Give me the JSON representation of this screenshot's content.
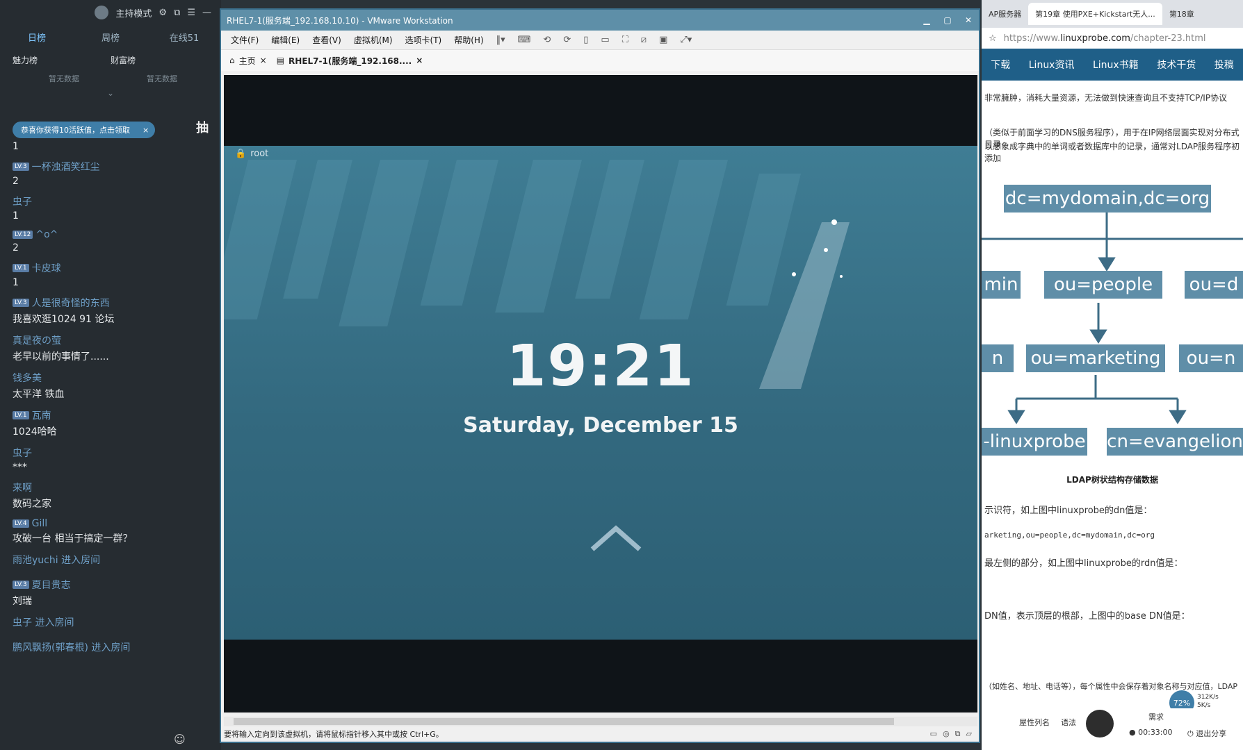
{
  "chat": {
    "mode": "主持模式",
    "tabs": [
      "日榜",
      "周榜",
      "在线51"
    ],
    "ranks": [
      {
        "title": "魅力榜",
        "empty": "暂无数据"
      },
      {
        "title": "财富榜",
        "empty": "暂无数据"
      }
    ],
    "notice": "恭喜你获得10活跃值，点击领取",
    "gift_label": "抽",
    "first_line": "1",
    "messages": [
      {
        "level": "LV.3",
        "user": "一杯浊酒笑红尘",
        "text": "2"
      },
      {
        "level": "",
        "user": "虫子",
        "text": "1"
      },
      {
        "level": "LV.12",
        "user": "^o^",
        "text": "2"
      },
      {
        "level": "LV.1",
        "user": "卡皮球",
        "text": "1"
      },
      {
        "level": "LV.3",
        "user": "人是很奇怪的东西",
        "text": "我喜欢逛1024 91 论坛"
      },
      {
        "level": "",
        "user": "真是夜の萤",
        "text": "老早以前的事情了......"
      },
      {
        "level": "",
        "user": "钱多美",
        "text": "太平洋 铁血"
      },
      {
        "level": "LV.1",
        "user": "瓦南",
        "text": "1024哈哈"
      },
      {
        "level": "",
        "user": "虫子",
        "text": "***"
      },
      {
        "level": "",
        "user": "来啊",
        "text": "数码之家"
      },
      {
        "level": "LV.4",
        "user": "Gill",
        "text": "攻破一台 相当于搞定一群？"
      },
      {
        "level": "",
        "user": "雨池yuchi 进入房间",
        "text": ""
      },
      {
        "level": "LV.3",
        "user": "夏目贵志",
        "text": "刘瑞"
      },
      {
        "level": "",
        "user": "虫子 进入房间",
        "text": ""
      },
      {
        "level": "",
        "user": "鹏风飘扬(郭春根) 进入房间",
        "text": ""
      }
    ]
  },
  "vm": {
    "title": "RHEL7-1(服务端_192.168.10.10) - VMware Workstation",
    "menu": [
      "文件(F)",
      "编辑(E)",
      "查看(V)",
      "虚拟机(M)",
      "选项卡(T)",
      "帮助(H)"
    ],
    "tabs": [
      {
        "label": "主页"
      },
      {
        "label": "RHEL7-1(服务端_192.168...."
      }
    ],
    "lock_screen": {
      "user": "root",
      "time": "19:21",
      "date": "Saturday, December 15"
    },
    "status_text": "要将输入定向到该虚拟机，请将鼠标指针移入其中或按 Ctrl+G。"
  },
  "browser": {
    "tabs": [
      "AP服务器",
      "第19章 使用PXE+Kickstart无人...",
      "第18章"
    ],
    "url_prefix": "https://www.",
    "url_domain": "linuxprobe.com",
    "url_suffix": "/chapter-23.html",
    "nav": [
      "下载",
      "Linux资讯",
      "Linux书籍",
      "技术干货",
      "投稿"
    ],
    "para1": "非常臃肿，消耗大量资源，无法做到快速查询且不支持TCP/IP协议",
    "para2": "（类似于前面学习的DNS服务程序），用于在IP网络层面实现对分布式目录",
    "para3": "以想象成字典中的单词或者数据库中的记录，通常对LDAP服务程序初添加",
    "nodes": {
      "root": "dc=mydomain,dc=org",
      "left1": "min",
      "people": "ou=people",
      "right1": "ou=d",
      "left2": "n",
      "marketing": "ou=marketing",
      "right2": "ou=n",
      "cn1": "-linuxprobe",
      "cn2": "cn=evangelion"
    },
    "caption": "LDAP树状结构存储数据",
    "dn_line": "示识符，如上图中linuxprobe的dn值是：",
    "dn_code": "arketing,ou=people,dc=mydomain,dc=org",
    "rdn_line": "最左侧的部分，如上图中linuxprobe的rdn值是：",
    "base_line": "DN值，表示顶层的根部，上图中的base DN值是：",
    "attr_line": "（如姓名、地址、电话等），每个属性中会保存着对象名称与对应值，LDAP",
    "speed": {
      "percent": "72%",
      "up": "312K/s",
      "down": "5K/s"
    },
    "footer": {
      "left": "屋性列名",
      "mid": "语法",
      "time": "00:33:00",
      "share": "退出分享",
      "label": "需求"
    }
  }
}
